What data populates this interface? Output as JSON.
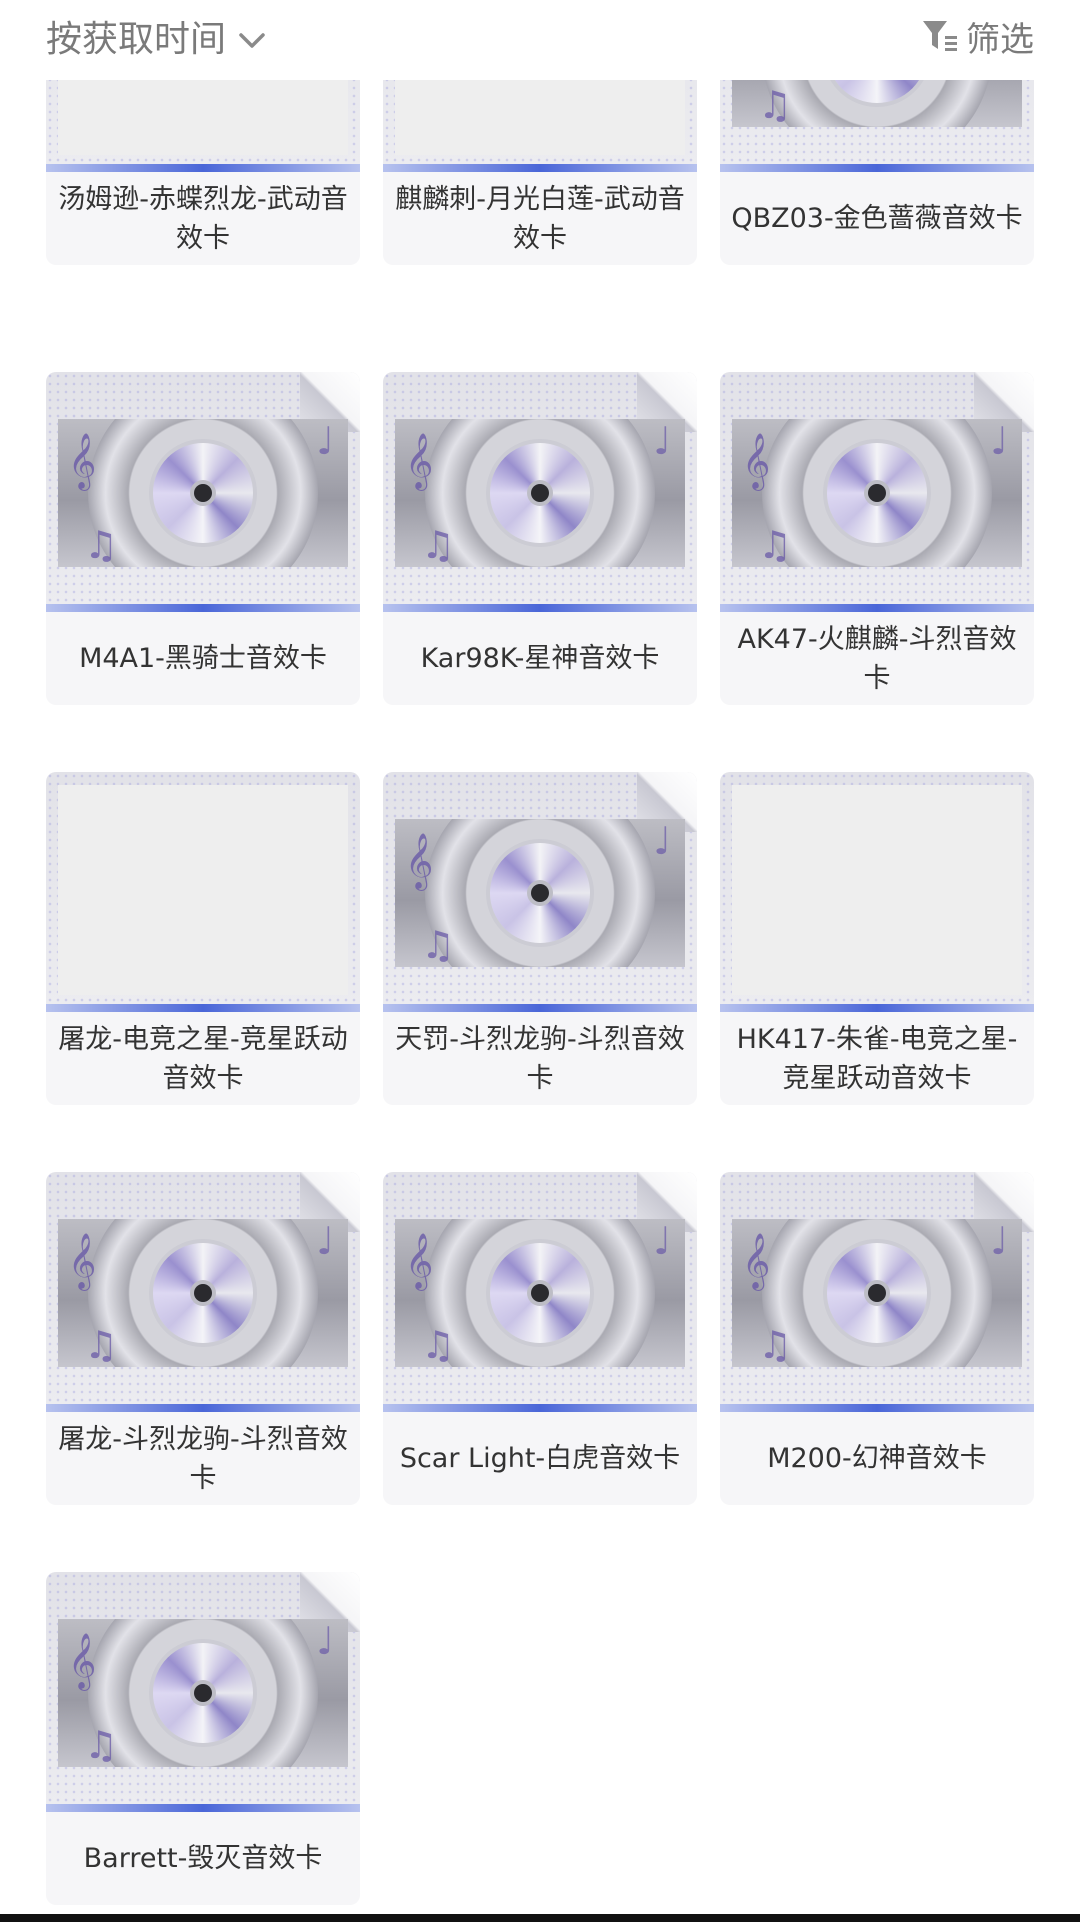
{
  "toolbar": {
    "sort_label": "按获取时间",
    "sort_icon": "chevron-down-icon",
    "filter_label": "筛选",
    "filter_icon": "funnel-icon"
  },
  "colors": {
    "card_bg": "#f6f6f8",
    "stripe": "#4a66d8",
    "toolbar_text": "#7a7a7a"
  },
  "cards": [
    {
      "name": "汤姆逊-赤蝶烈龙-武动音效卡",
      "thumb": "blank"
    },
    {
      "name": "麒麟刺-月光白莲-武动音效卡",
      "thumb": "blank"
    },
    {
      "name": "QBZ03-金色蔷薇音效卡",
      "thumb": "disc"
    },
    {
      "name": "M4A1-黑骑士音效卡",
      "thumb": "disc"
    },
    {
      "name": "Kar98K-星神音效卡",
      "thumb": "disc"
    },
    {
      "name": "AK47-火麒麟-斗烈音效卡",
      "thumb": "disc"
    },
    {
      "name": "屠龙-电竞之星-竞星跃动音效卡",
      "thumb": "blank"
    },
    {
      "name": "天罚-斗烈龙驹-斗烈音效卡",
      "thumb": "disc"
    },
    {
      "name": "HK417-朱雀-电竞之星-竞星跃动音效卡",
      "thumb": "blank"
    },
    {
      "name": "屠龙-斗烈龙驹-斗烈音效卡",
      "thumb": "disc"
    },
    {
      "name": "Scar Light-白虎音效卡",
      "thumb": "disc"
    },
    {
      "name": "M200-幻神音效卡",
      "thumb": "disc"
    },
    {
      "name": "Barrett-毁灭音效卡",
      "thumb": "disc"
    }
  ]
}
